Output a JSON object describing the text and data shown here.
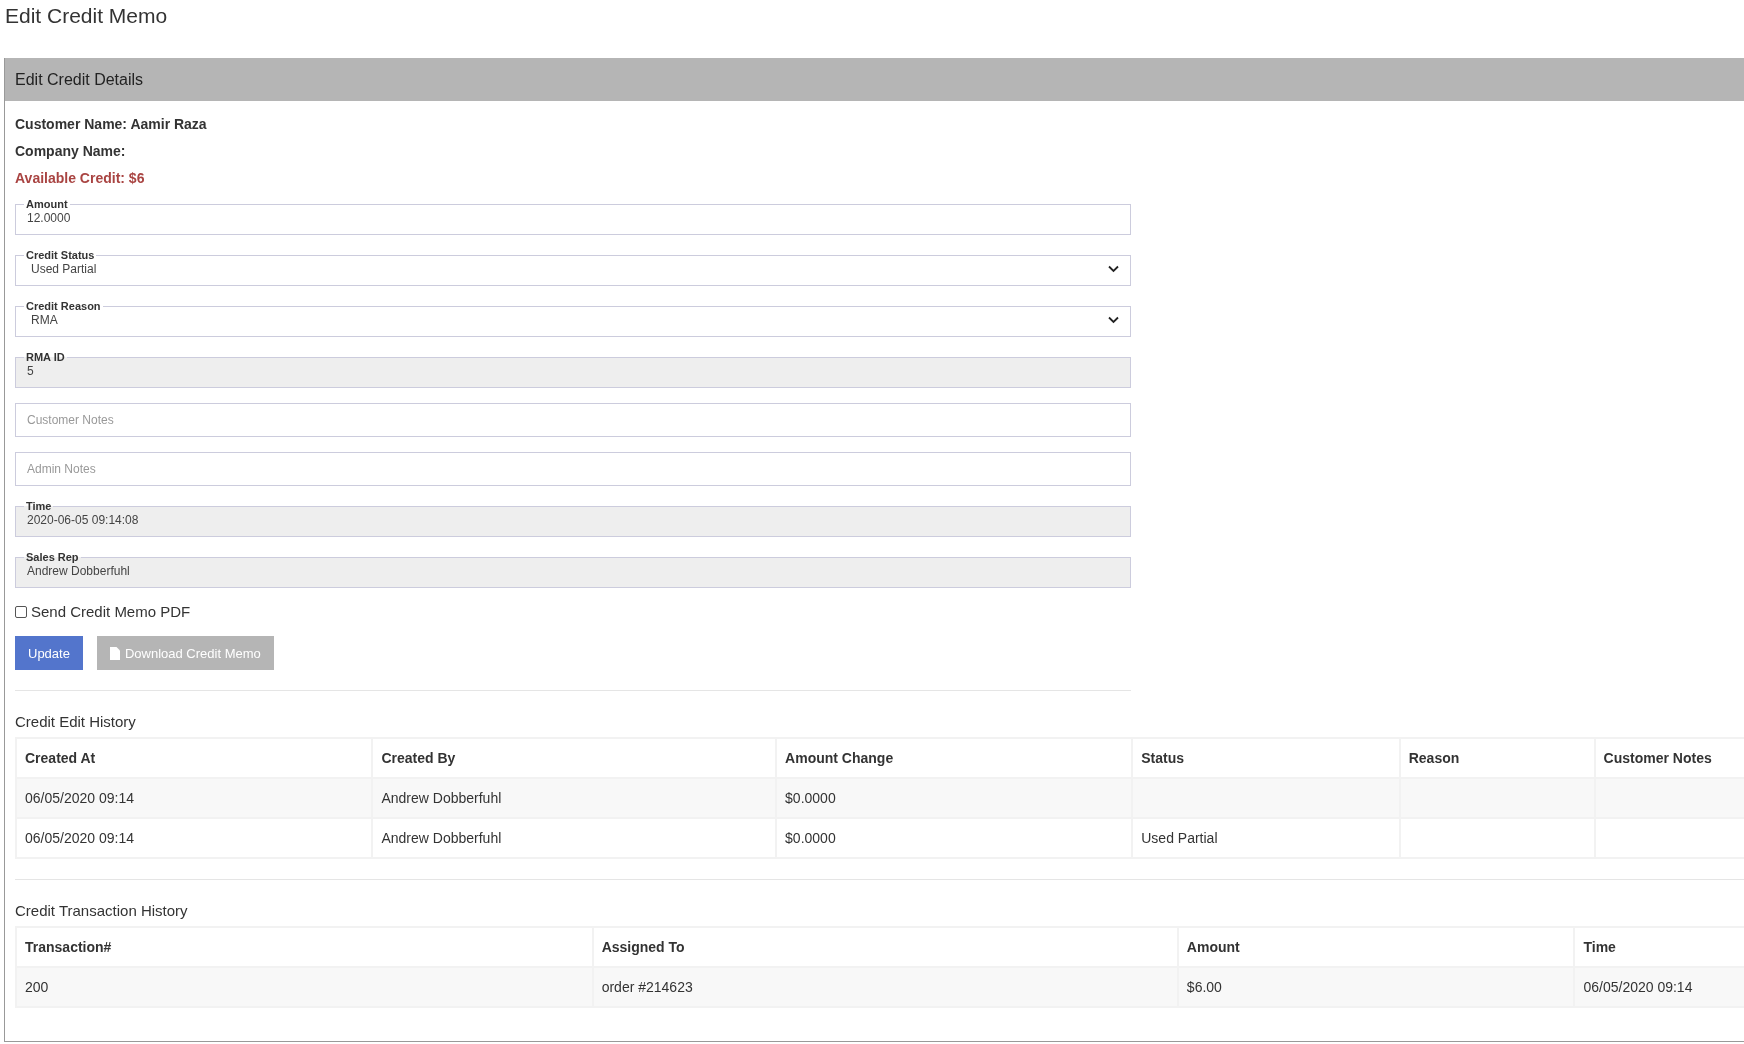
{
  "page_title": "Edit Credit Memo",
  "panel": {
    "title": "Edit Credit Details",
    "info": [
      {
        "kind": "plain",
        "text": "Customer Name: Aamir Raza"
      },
      {
        "kind": "plain",
        "text": "Company Name:"
      },
      {
        "kind": "alert",
        "text": "Available Credit: $6"
      }
    ],
    "fields": [
      {
        "kind": "text",
        "label": "Amount",
        "value": "12.0000",
        "disabled": false
      },
      {
        "kind": "select",
        "label": "Credit Status",
        "value": "Used Partial",
        "disabled": false
      },
      {
        "kind": "select",
        "label": "Credit Reason",
        "value": "RMA",
        "disabled": false
      },
      {
        "kind": "text",
        "label": "RMA ID",
        "value": "5",
        "disabled": true
      },
      {
        "kind": "empty",
        "placeholder": "Customer Notes",
        "disabled": false
      },
      {
        "kind": "empty",
        "placeholder": "Admin Notes",
        "disabled": false
      },
      {
        "kind": "text",
        "label": "Time",
        "value": "2020-06-05 09:14:08",
        "disabled": true
      },
      {
        "kind": "text",
        "label": "Sales Rep",
        "value": "Andrew Dobberfuhl",
        "disabled": true
      }
    ],
    "send_pdf": {
      "label": "Send Credit Memo PDF",
      "checked": false
    },
    "buttons": [
      {
        "kind": "primary",
        "label": "Update"
      },
      {
        "kind": "secondary",
        "label": "Download Credit Memo"
      }
    ],
    "edit_history": {
      "title": "Credit Edit History",
      "columns": [
        "Created At",
        "Created By",
        "Amount Change",
        "Status",
        "Reason",
        "Customer Notes"
      ],
      "rows": [
        [
          "06/05/2020 09:14",
          "Andrew Dobberfuhl",
          "$0.0000",
          "",
          "",
          ""
        ],
        [
          "06/05/2020 09:14",
          "Andrew Dobberfuhl",
          "$0.0000",
          "Used Partial",
          "",
          ""
        ]
      ]
    },
    "transaction_history": {
      "title": "Credit Transaction History",
      "columns": [
        "Transaction#",
        "Assigned To",
        "Amount",
        "Time"
      ],
      "rows": [
        [
          "200",
          "order #214623",
          "$6.00",
          "06/05/2020 09:14"
        ]
      ]
    }
  }
}
